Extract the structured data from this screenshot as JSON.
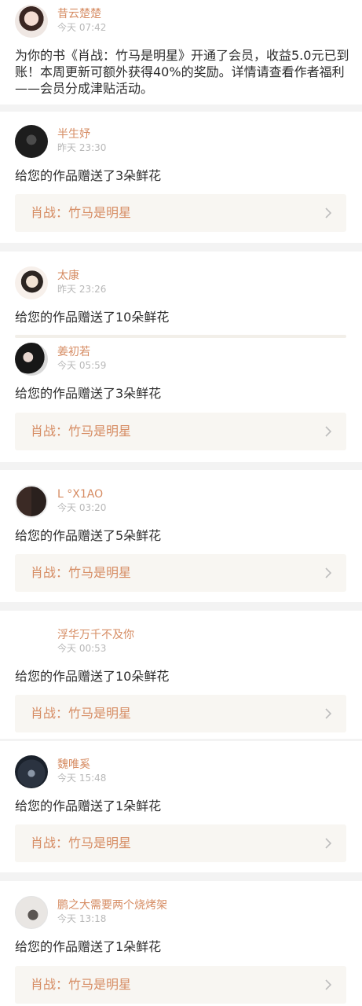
{
  "notifications": [
    {
      "user": "昔云楚楚",
      "time": "今天 07:42",
      "message": "为你的书《肖战：竹马是明星》开通了会员，收益5.0元已到账！本周更新可额外获得40%的奖励。详情请查看作者福利——会员分成津贴活动。"
    },
    {
      "user": "半生妤",
      "time": "昨天 23:30",
      "message": "给您的作品赠送了3朵鲜花",
      "book": "肖战：竹马是明星"
    },
    {
      "user": "太康",
      "time": "昨天 23:26",
      "message": "给您的作品赠送了10朵鲜花"
    },
    {
      "user": "姜初若",
      "time": "今天 05:59",
      "message": "给您的作品赠送了3朵鲜花",
      "book": "肖战：竹马是明星"
    },
    {
      "user": "L °X1AO",
      "time": "今天 03:20",
      "message": "给您的作品赠送了5朵鲜花",
      "book": "肖战：竹马是明星"
    },
    {
      "user": "浮华万千不及你",
      "time": "今天 00:53",
      "message": "给您的作品赠送了10朵鲜花",
      "book": "肖战：竹马是明星"
    },
    {
      "user": "魏唯奚",
      "time": "今天 15:48",
      "message": "给您的作品赠送了1朵鲜花",
      "book": "肖战：竹马是明星"
    },
    {
      "user": "鹏之大需要两个烧烤架",
      "time": "今天 13:18",
      "message": "给您的作品赠送了1朵鲜花",
      "book": "肖战：竹马是明星"
    }
  ],
  "colors": {
    "accent": "#d68c63",
    "card_bg": "#f8f6f2",
    "divider": "#f3f3f3",
    "time": "#b8b8b8",
    "text": "#2b2b2b"
  },
  "icons": {
    "card_arrow": "chevron-right-icon"
  }
}
